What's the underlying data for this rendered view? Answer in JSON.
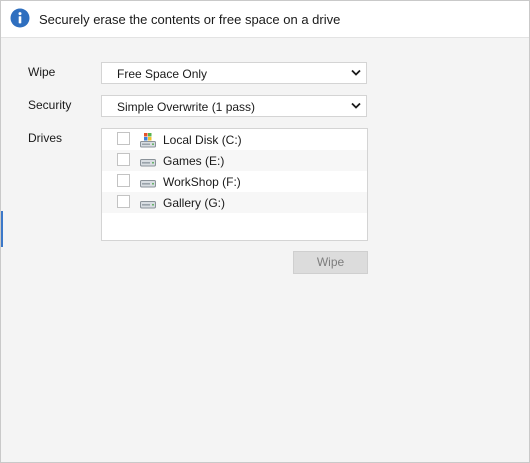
{
  "header": {
    "text": "Securely erase the contents or free space on a drive",
    "icon": "info-icon",
    "icon_color": "#2f6fbf"
  },
  "form": {
    "wipe": {
      "label": "Wipe",
      "value": "Free Space Only"
    },
    "security": {
      "label": "Security",
      "value": "Simple Overwrite (1 pass)"
    },
    "drives": {
      "label": "Drives",
      "items": [
        {
          "label": "Local Disk (C:)",
          "icon": "windows-drive-icon",
          "checked": false
        },
        {
          "label": "Games (E:)",
          "icon": "hard-drive-icon",
          "checked": false
        },
        {
          "label": "WorkShop (F:)",
          "icon": "hard-drive-icon",
          "checked": false
        },
        {
          "label": "Gallery (G:)",
          "icon": "hard-drive-icon",
          "checked": false
        }
      ]
    }
  },
  "actions": {
    "wipe_button": {
      "label": "Wipe",
      "enabled": false
    }
  },
  "colors": {
    "accent": "#3b78c9",
    "background": "#f4f4f4",
    "disabled_button": "#dcdcdc"
  }
}
